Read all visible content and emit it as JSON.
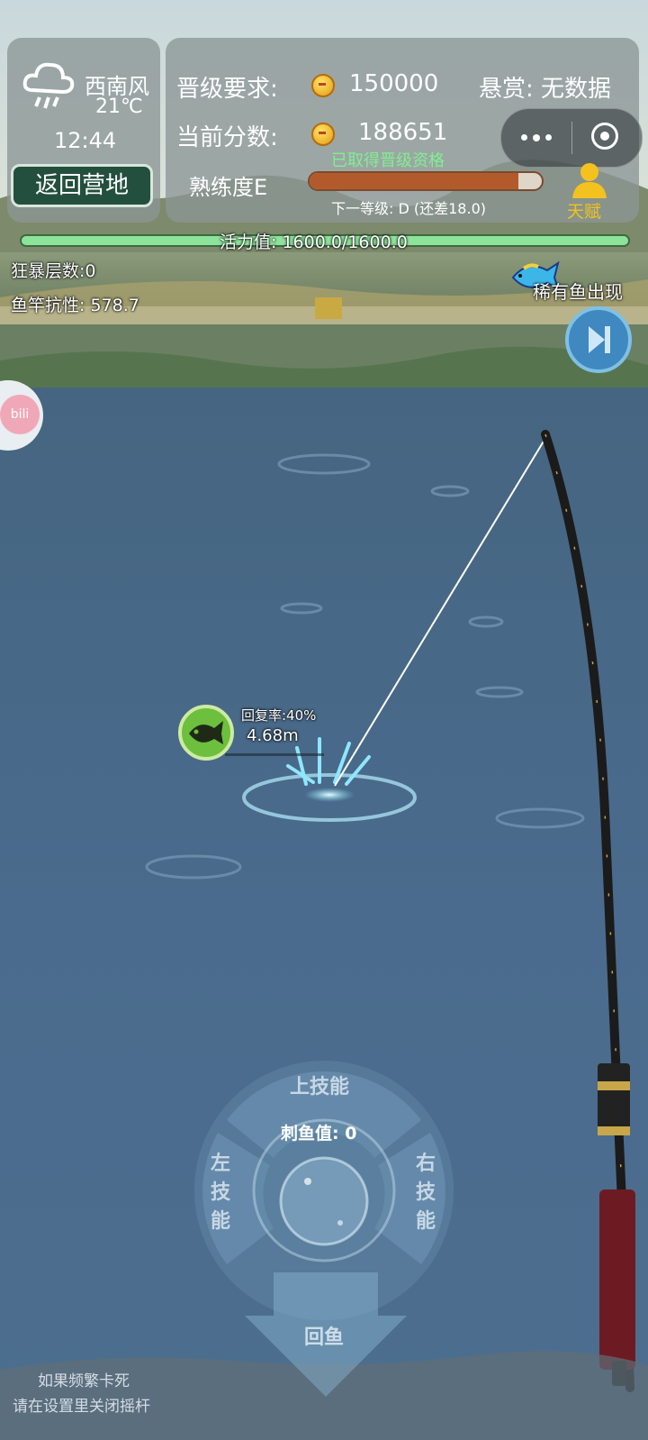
{
  "weather": {
    "icon": "rain-cloud-icon",
    "wind": "西南风",
    "temp": "21℃",
    "time": "12:44"
  },
  "camp_button": "返回营地",
  "promotion": {
    "label": "晋级要求:",
    "value": "150000"
  },
  "bounty": "悬赏: 无数据",
  "current_score": {
    "label": "当前分数:",
    "value": "188651"
  },
  "qualified_text": "已取得晋级资格",
  "proficiency": {
    "label": "熟练度E",
    "progress": 0.9,
    "next_level": "下一等级: D (还差18.0)"
  },
  "talent": "天赋",
  "vitality": {
    "label": "活力值: 1600.0/1600.0",
    "current": 1600,
    "max": 1600
  },
  "stats": {
    "frenzy": "狂暴层数:0",
    "rod_resistance": "鱼竿抗性: 578.7"
  },
  "rare_fish": "稀有鱼出现",
  "fish_hud": {
    "recovery": "回复率:40%",
    "distance": "4.68m"
  },
  "controls": {
    "up": "上技能",
    "left": "左技能",
    "right": "右技能",
    "stab": "刺鱼值: 0",
    "reel": "回鱼"
  },
  "hint": {
    "line1": "如果频繁卡死",
    "line2": "请在设置里关闭摇杆"
  },
  "side_logo": "bili",
  "colors": {
    "water": "#4a6a8c",
    "panel": "#8c9696",
    "accent_green": "#234f3f",
    "progress": "#b35a2c",
    "qualified": "#7ff08f"
  }
}
